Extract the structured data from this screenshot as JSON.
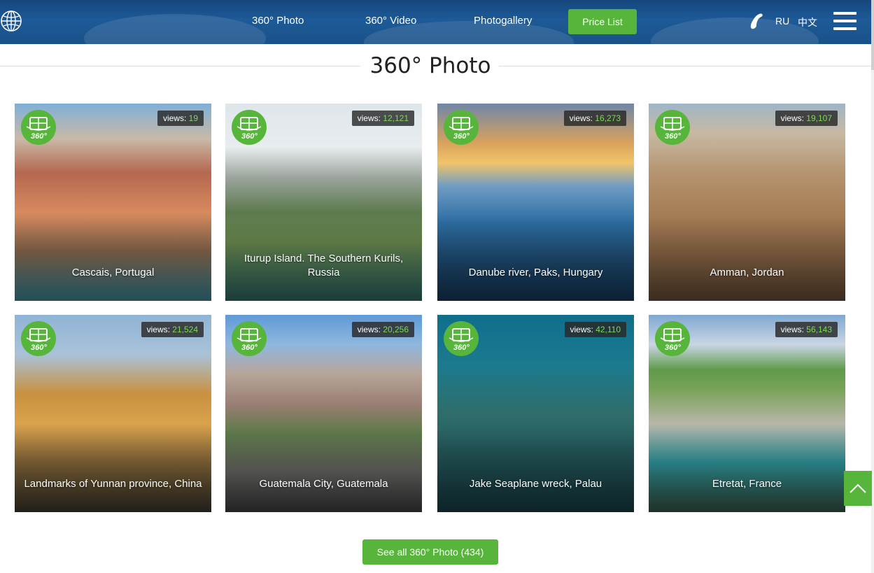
{
  "header": {
    "nav": [
      {
        "label": "360° Photo"
      },
      {
        "label": "360° Video"
      },
      {
        "label": "Photogallery"
      }
    ],
    "price_button": "Price List",
    "languages": [
      "RU",
      "中文"
    ]
  },
  "section": {
    "title": "360° Photo"
  },
  "cards": [
    {
      "views_label": "views:",
      "views": "19",
      "caption": "Cascais, Portugal",
      "badge": "360°"
    },
    {
      "views_label": "views:",
      "views": "12,121",
      "caption": "Iturup Island. The Southern Kurils, Russia",
      "badge": "360°"
    },
    {
      "views_label": "views:",
      "views": "16,273",
      "caption": "Danube river, Paks, Hungary",
      "badge": "360°"
    },
    {
      "views_label": "views:",
      "views": "19,107",
      "caption": "Amman, Jordan",
      "badge": "360°"
    },
    {
      "views_label": "views:",
      "views": "21,524",
      "caption": "Landmarks of Yunnan province, China",
      "badge": "360°"
    },
    {
      "views_label": "views:",
      "views": "20,256",
      "caption": "Guatemala City, Guatemala",
      "badge": "360°"
    },
    {
      "views_label": "views:",
      "views": "42,110",
      "caption": "Jake Seaplane wreck, Palau",
      "badge": "360°"
    },
    {
      "views_label": "views:",
      "views": "56,143",
      "caption": "Etretat, France",
      "badge": "360°"
    }
  ],
  "see_all_button": "See all 360° Photo (434)",
  "colors": {
    "accent_green": "#56b53a",
    "views_number": "#7ed957",
    "header_blue": "#1d5a97"
  },
  "icons": [
    "globe-icon",
    "phone-icon",
    "menu-icon",
    "panorama-360-icon",
    "arrow-up-icon"
  ]
}
